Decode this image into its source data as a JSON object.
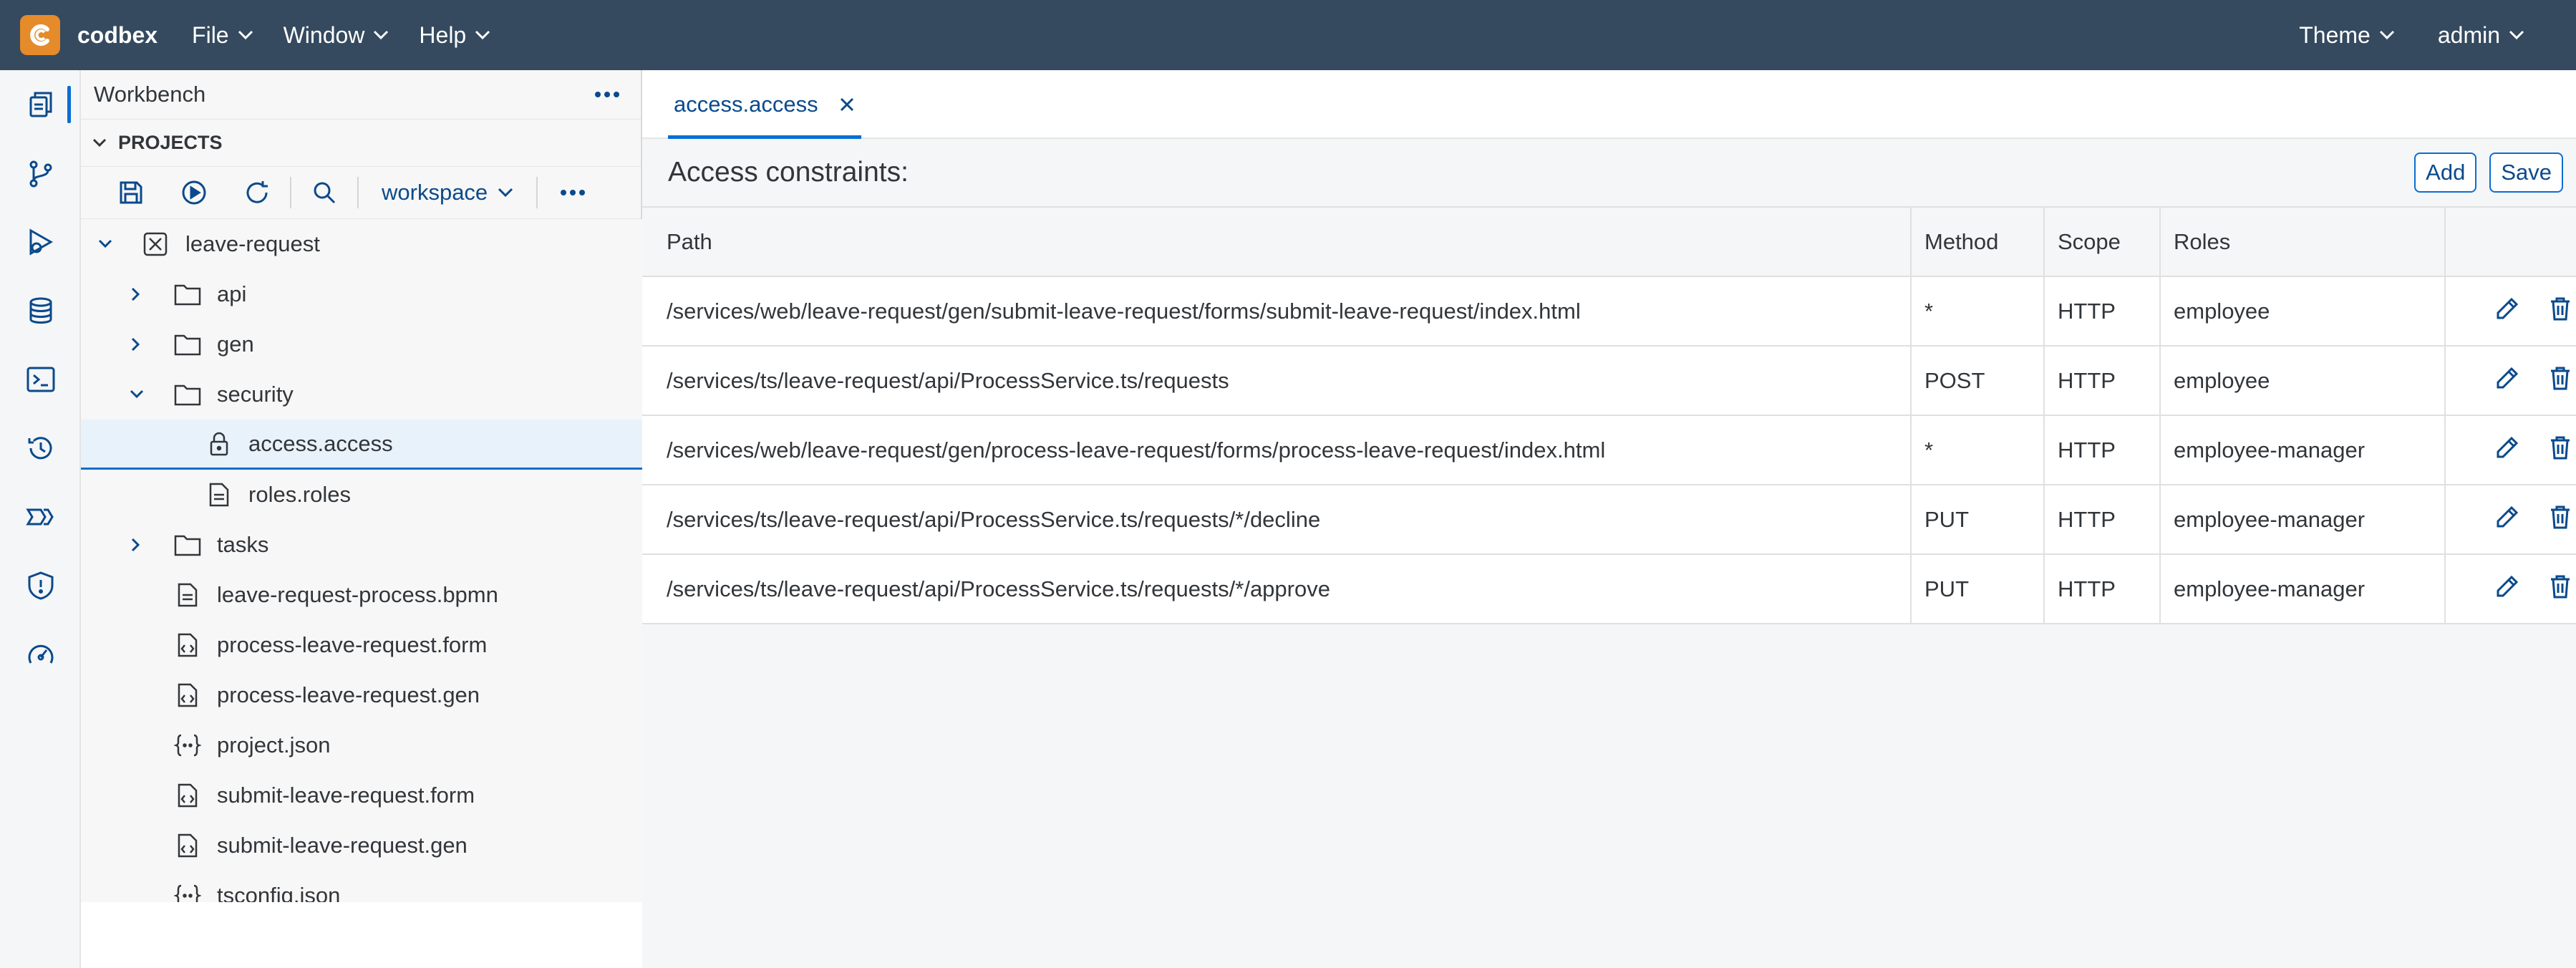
{
  "shellbar": {
    "app_name": "codbex",
    "menus": [
      "File",
      "Window",
      "Help"
    ],
    "theme_label": "Theme",
    "user_label": "admin"
  },
  "activity_bar": {
    "items": [
      "projects-icon",
      "git-icon",
      "debug-icon",
      "database-icon",
      "terminal-icon",
      "history-icon",
      "processes-icon",
      "security-icon",
      "monitoring-icon"
    ]
  },
  "sidebar": {
    "title": "Workbench",
    "projects_label": "PROJECTS",
    "workspace": "workspace",
    "tree": [
      {
        "label": "leave-request",
        "icon": "project-icon",
        "expanded": true
      },
      {
        "label": "api",
        "icon": "folder-icon",
        "expanded": false
      },
      {
        "label": "gen",
        "icon": "folder-icon",
        "expanded": false
      },
      {
        "label": "security",
        "icon": "folder-icon",
        "expanded": true
      },
      {
        "label": "access.access",
        "icon": "lock-icon",
        "selected": true
      },
      {
        "label": "roles.roles",
        "icon": "file-icon"
      },
      {
        "label": "tasks",
        "icon": "folder-icon",
        "expanded": false
      },
      {
        "label": "leave-request-process.bpmn",
        "icon": "file-icon"
      },
      {
        "label": "process-leave-request.form",
        "icon": "code-file-icon"
      },
      {
        "label": "process-leave-request.gen",
        "icon": "code-file-icon"
      },
      {
        "label": "project.json",
        "icon": "json-icon"
      },
      {
        "label": "submit-leave-request.form",
        "icon": "code-file-icon"
      },
      {
        "label": "submit-leave-request.gen",
        "icon": "code-file-icon"
      },
      {
        "label": "tsconfig.json",
        "icon": "json-icon"
      }
    ]
  },
  "editor": {
    "tab_label": "access.access",
    "title": "Access constraints:",
    "add_label": "Add",
    "save_label": "Save",
    "columns": {
      "path": "Path",
      "method": "Method",
      "scope": "Scope",
      "roles": "Roles"
    },
    "rows": [
      {
        "path": "/services/web/leave-request/gen/submit-leave-request/forms/submit-leave-request/index.html",
        "method": "*",
        "scope": "HTTP",
        "roles": "employee"
      },
      {
        "path": "/services/ts/leave-request/api/ProcessService.ts/requests",
        "method": "POST",
        "scope": "HTTP",
        "roles": "employee"
      },
      {
        "path": "/services/web/leave-request/gen/process-leave-request/forms/process-leave-request/index.html",
        "method": "*",
        "scope": "HTTP",
        "roles": "employee-manager"
      },
      {
        "path": "/services/ts/leave-request/api/ProcessService.ts/requests/*/decline",
        "method": "PUT",
        "scope": "HTTP",
        "roles": "employee-manager"
      },
      {
        "path": "/services/ts/leave-request/api/ProcessService.ts/requests/*/approve",
        "method": "PUT",
        "scope": "HTTP",
        "roles": "employee-manager"
      }
    ]
  },
  "colors": {
    "shellbar": "#354a5f",
    "accent": "#0a6ed1",
    "logo": "#e58b2a"
  }
}
